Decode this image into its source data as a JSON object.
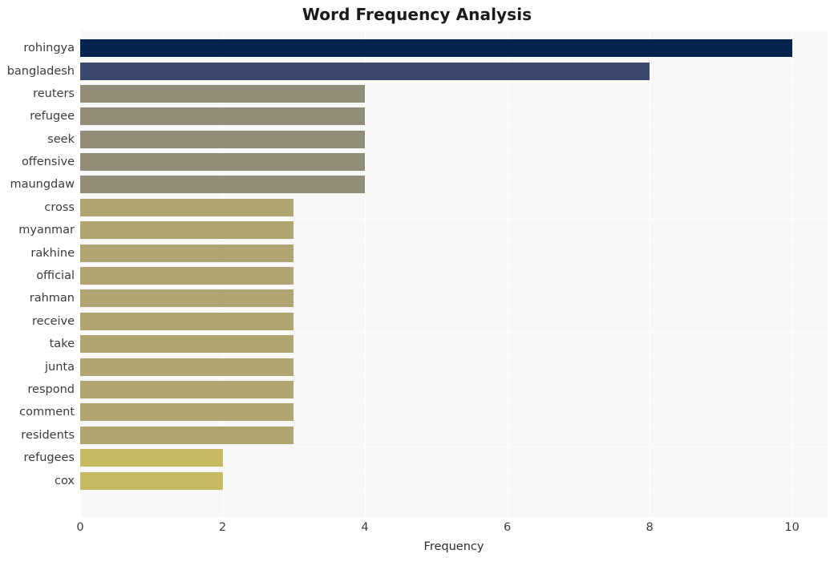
{
  "chart_data": {
    "type": "bar",
    "orientation": "horizontal",
    "title": "Word Frequency Analysis",
    "xlabel": "Frequency",
    "ylabel": "",
    "categories": [
      "rohingya",
      "bangladesh",
      "reuters",
      "refugee",
      "seek",
      "offensive",
      "maungdaw",
      "cross",
      "myanmar",
      "rakhine",
      "official",
      "rahman",
      "receive",
      "take",
      "junta",
      "respond",
      "comment",
      "residents",
      "refugees",
      "cox"
    ],
    "values": [
      10,
      8,
      4,
      4,
      4,
      4,
      4,
      3,
      3,
      3,
      3,
      3,
      3,
      3,
      3,
      3,
      3,
      3,
      2,
      2
    ],
    "bar_colors": [
      "#03244d",
      "#3c476e",
      "#928d79",
      "#928d79",
      "#928d79",
      "#928d79",
      "#928d79",
      "#b0a470",
      "#b0a470",
      "#b0a470",
      "#b0a470",
      "#b0a470",
      "#b0a470",
      "#b0a470",
      "#b0a470",
      "#b0a470",
      "#b0a470",
      "#b0a470",
      "#c5b962",
      "#c5b962"
    ],
    "xlim": [
      0,
      10.5
    ],
    "xticks": [
      0,
      2,
      4,
      6,
      8,
      10
    ],
    "xticklabels": [
      "0",
      "2",
      "4",
      "6",
      "8",
      "10"
    ],
    "grid": true,
    "grid_axis": "x",
    "legend": null,
    "plot_background": "#f7f7f7",
    "figure_background": "#ffffff",
    "gridline_color": "#ffffff"
  }
}
